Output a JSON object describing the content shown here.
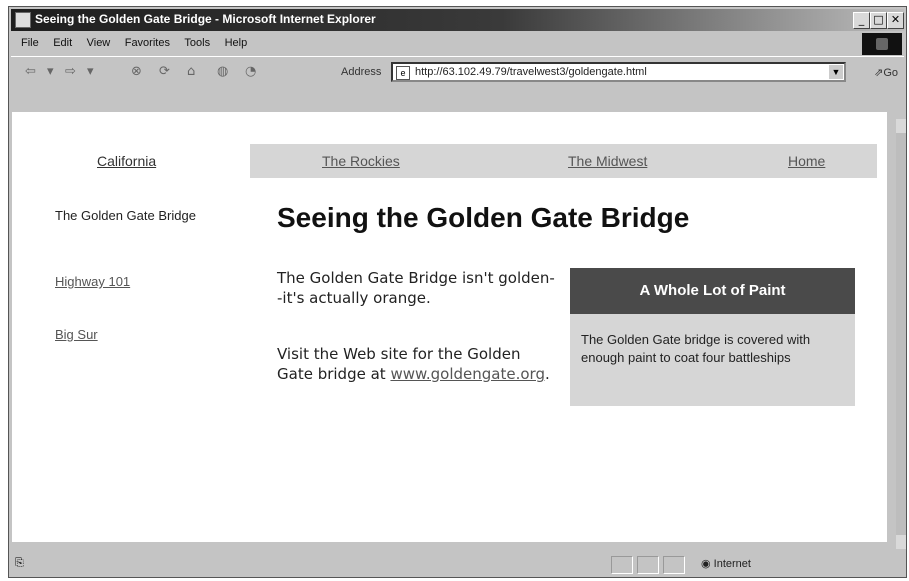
{
  "window": {
    "title": "Seeing the Golden Gate Bridge - Microsoft Internet Explorer",
    "minimize": "_",
    "maximize": "□",
    "close": "✕"
  },
  "menu": {
    "items": [
      {
        "label": "File"
      },
      {
        "label": "Edit"
      },
      {
        "label": "View"
      },
      {
        "label": "Favorites"
      },
      {
        "label": "Tools"
      },
      {
        "label": "Help"
      }
    ]
  },
  "toolbar": {
    "address_label": "Address",
    "url": "http://63.102.49.79/travelwest3/goldengate.html",
    "go_label": "Go"
  },
  "page": {
    "nav": {
      "active": "California",
      "items": [
        "The Rockies",
        "The Midwest",
        "Home"
      ]
    },
    "sidebar": {
      "current": "The Golden Gate Bridge",
      "links": [
        "Highway 101",
        "Big Sur"
      ]
    },
    "heading": "Seeing the Golden Gate Bridge",
    "para1": "The Golden Gate Bridge isn't golden--it's actually orange.",
    "para2_text": "Visit the Web site for the Golden Gate bridge at",
    "para2_link": "www.goldengate.org",
    "para2_end": ".",
    "aside": {
      "title": "A Whole Lot of Paint",
      "text": "The Golden Gate bridge is covered with enough paint to coat four battleships"
    }
  },
  "status": {
    "zone": "Internet"
  },
  "colors": {
    "nav_bar": "#d6d6d6",
    "aside_header": "#4a4a4a",
    "link": "#555555"
  }
}
